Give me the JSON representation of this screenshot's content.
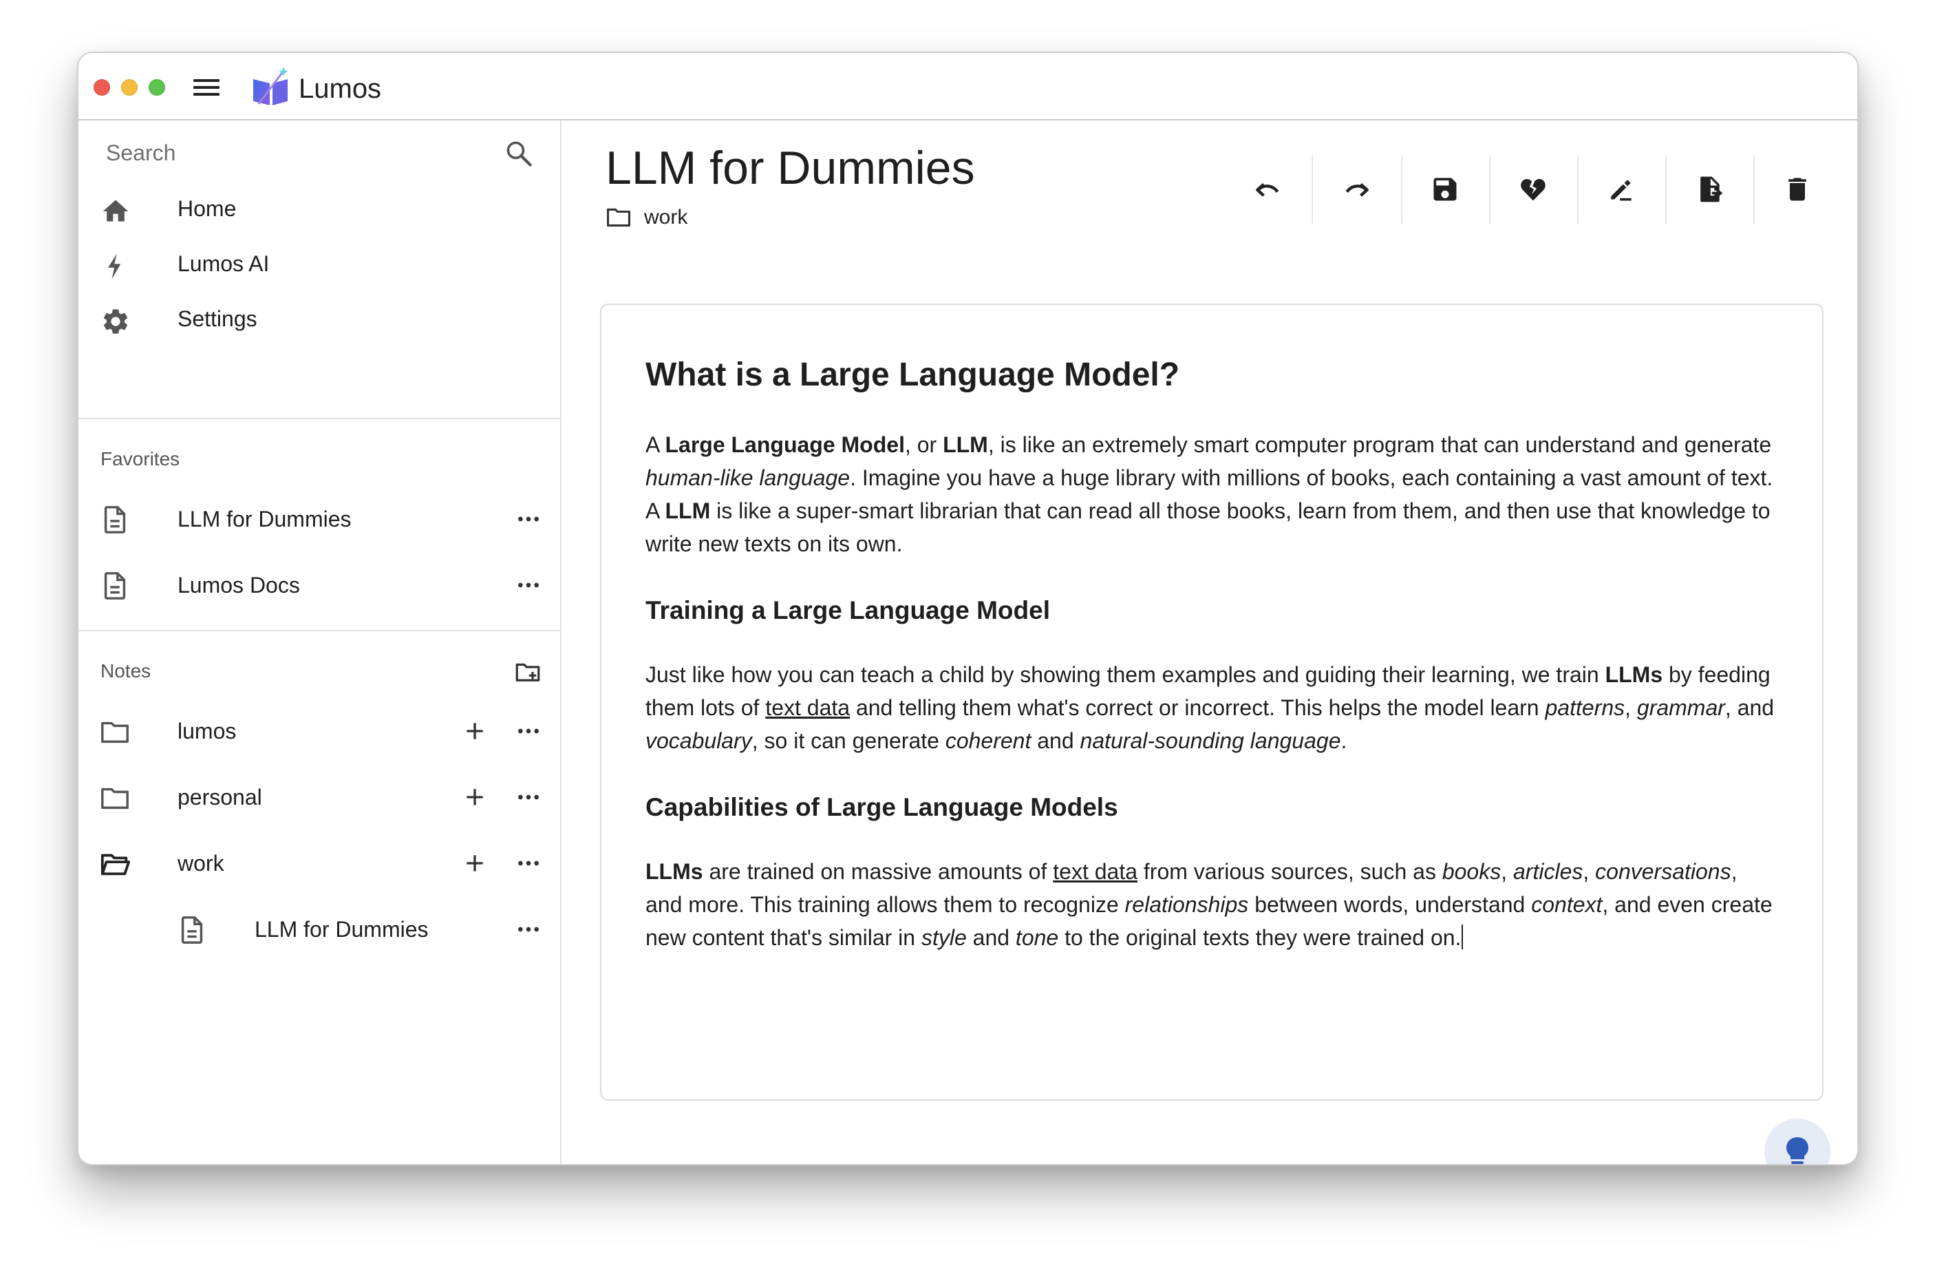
{
  "app": {
    "title": "Lumos"
  },
  "search": {
    "placeholder": "Search"
  },
  "nav": [
    {
      "label": "Home",
      "icon": "home-icon"
    },
    {
      "label": "Lumos AI",
      "icon": "bolt-icon"
    },
    {
      "label": "Settings",
      "icon": "gear-icon"
    }
  ],
  "favorites": {
    "title": "Favorites",
    "items": [
      {
        "label": "LLM for Dummies",
        "icon": "document-icon"
      },
      {
        "label": "Lumos Docs",
        "icon": "document-icon"
      }
    ]
  },
  "notes": {
    "title": "Notes",
    "folders": [
      {
        "label": "lumos",
        "icon": "folder-icon",
        "open": false
      },
      {
        "label": "personal",
        "icon": "folder-icon",
        "open": false
      },
      {
        "label": "work",
        "icon": "folder-open-icon",
        "open": true,
        "children": [
          {
            "label": "LLM for Dummies",
            "icon": "document-icon"
          }
        ]
      }
    ]
  },
  "document": {
    "title": "LLM for Dummies",
    "folder": "work",
    "heading": "What is a Large Language Model?",
    "p1": {
      "t1": "A ",
      "b1": "Large Language Model",
      "t2": ", or ",
      "b2": "LLM",
      "t3": ", is like an extremely smart computer program that can understand and generate ",
      "i1": "human-like language",
      "t4": ". Imagine you have a huge library with millions of books, each containing a vast amount of text. A ",
      "b3": "LLM",
      "t5": " is like a super-smart librarian that can read all those books, learn from them, and then use that knowledge to write new texts on its own."
    },
    "h_training": "Training a Large Language Model",
    "p2": {
      "t1": "Just like how you can teach a child by showing them examples and guiding their learning, we train ",
      "b1": "LLMs",
      "t2": " by feeding them lots of ",
      "u1": "text data",
      "t3": " and telling them what's correct or incorrect. This helps the model learn ",
      "i1": "patterns",
      "t4": ", ",
      "i2": "grammar",
      "t5": ", and ",
      "i3": "vocabulary",
      "t6": ", so it can generate ",
      "i4": "coherent",
      "t7": " and ",
      "i5": "natural-sounding language",
      "t8": "."
    },
    "h_capabilities": "Capabilities of Large Language Models",
    "p3": {
      "b1": "LLMs",
      "t1": " are trained on massive amounts of ",
      "u1": "text data",
      "t2": " from various sources, such as ",
      "i1": "books",
      "t3": ", ",
      "i2": "articles",
      "t4": ", ",
      "i3": "conversations",
      "t5": ", and more. This training allows them to recognize ",
      "i4": "relationships",
      "t6": " between words, understand ",
      "i5": "context",
      "t7": ", and even create new content that's similar in ",
      "i6": "style",
      "t8": " and ",
      "i7": "tone",
      "t9": " to the original texts they were trained on."
    }
  },
  "toolbar": [
    {
      "icon": "undo-icon"
    },
    {
      "icon": "redo-icon"
    },
    {
      "icon": "save-icon"
    },
    {
      "icon": "heart-broken-icon"
    },
    {
      "icon": "edit-icon"
    },
    {
      "icon": "file-move-icon"
    },
    {
      "icon": "delete-icon"
    }
  ],
  "fab": {
    "icon": "lightbulb-icon"
  },
  "colors": {
    "traffic_red": "#ee5b53",
    "traffic_yellow": "#f4bd3f",
    "traffic_green": "#5cc44d",
    "fab_background": "#e4ebf5",
    "fab_icon": "#2e5cb8"
  }
}
